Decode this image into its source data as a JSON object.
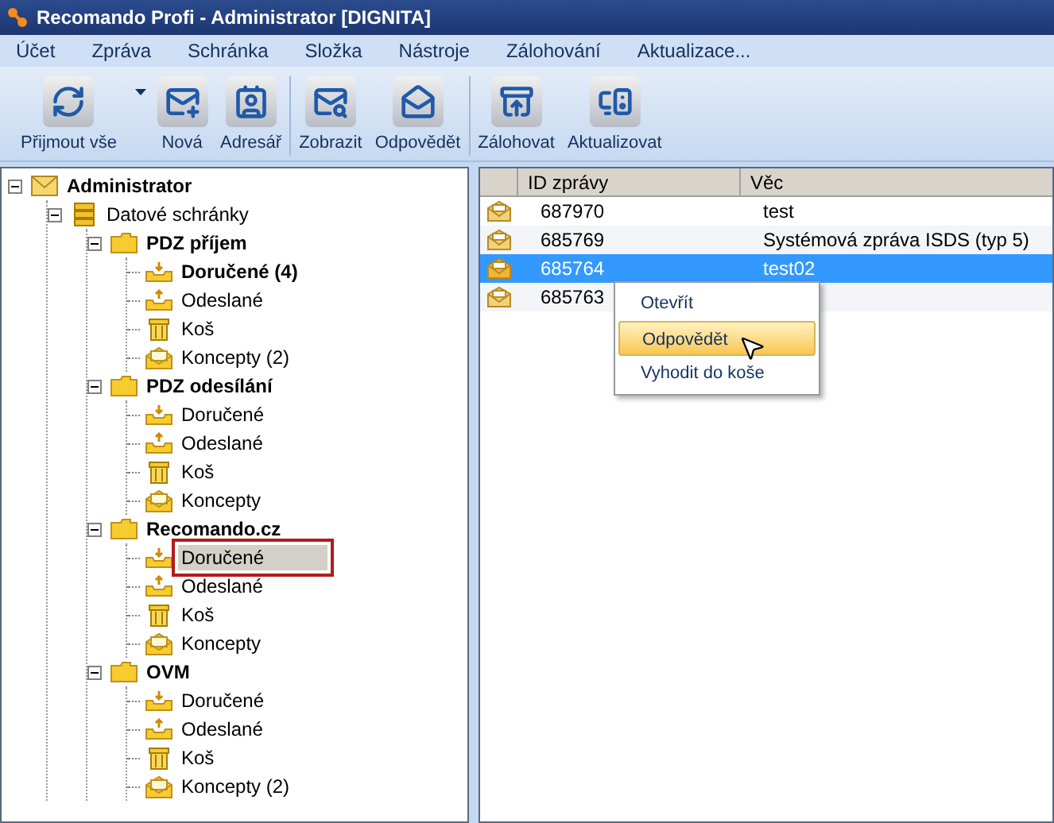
{
  "window": {
    "title": "Recomando Profi - Administrator [DIGNITA]"
  },
  "menu": [
    "Účet",
    "Zpráva",
    "Schránka",
    "Složka",
    "Nástroje",
    "Zálohování",
    "Aktualizace..."
  ],
  "toolbar": [
    [
      {
        "label": "Přijmout vše",
        "kind": "sync",
        "dropdown": true
      },
      {
        "label": "Nová",
        "kind": "new"
      },
      {
        "label": "Adresář",
        "kind": "contacts"
      }
    ],
    [
      {
        "label": "Zobrazit",
        "kind": "view"
      },
      {
        "label": "Odpovědět",
        "kind": "reply"
      }
    ],
    [
      {
        "label": "Zálohovat",
        "kind": "backup"
      },
      {
        "label": "Aktualizovat",
        "kind": "update"
      }
    ]
  ],
  "tree": [
    {
      "label": "Administrator",
      "kind": "account",
      "bold": true,
      "expanded": true,
      "selected": false,
      "children": [
        {
          "label": "Datové schránky",
          "kind": "boxes",
          "bold": false,
          "expanded": true,
          "selected": false,
          "children": [
            {
              "label": "PDZ příjem",
              "kind": "folder",
              "bold": true,
              "expanded": true,
              "selected": false,
              "children": [
                {
                  "label": "Doručené (4)",
                  "kind": "inbox",
                  "bold": true,
                  "selected": false
                },
                {
                  "label": "Odeslané",
                  "kind": "outbox",
                  "bold": false,
                  "selected": false
                },
                {
                  "label": "Koš",
                  "kind": "trash",
                  "bold": false,
                  "selected": false
                },
                {
                  "label": "Koncepty (2)",
                  "kind": "drafts",
                  "bold": false,
                  "selected": false
                }
              ]
            },
            {
              "label": "PDZ odesílání",
              "kind": "folder",
              "bold": true,
              "expanded": true,
              "selected": false,
              "children": [
                {
                  "label": "Doručené",
                  "kind": "inbox",
                  "bold": false,
                  "selected": false
                },
                {
                  "label": "Odeslané",
                  "kind": "outbox",
                  "bold": false,
                  "selected": false
                },
                {
                  "label": "Koš",
                  "kind": "trash",
                  "bold": false,
                  "selected": false
                },
                {
                  "label": "Koncepty",
                  "kind": "drafts",
                  "bold": false,
                  "selected": false
                }
              ]
            },
            {
              "label": "Recomando.cz",
              "kind": "folder",
              "bold": true,
              "expanded": true,
              "selected": false,
              "children": [
                {
                  "label": "Doručené",
                  "kind": "inbox",
                  "bold": false,
                  "selected": true
                },
                {
                  "label": "Odeslané",
                  "kind": "outbox",
                  "bold": false,
                  "selected": false
                },
                {
                  "label": "Koš",
                  "kind": "trash",
                  "bold": false,
                  "selected": false
                },
                {
                  "label": "Koncepty",
                  "kind": "drafts",
                  "bold": false,
                  "selected": false
                }
              ]
            },
            {
              "label": "OVM",
              "kind": "folder",
              "bold": true,
              "expanded": true,
              "selected": false,
              "children": [
                {
                  "label": "Doručené",
                  "kind": "inbox",
                  "bold": false,
                  "selected": false
                },
                {
                  "label": "Odeslané",
                  "kind": "outbox",
                  "bold": false,
                  "selected": false
                },
                {
                  "label": "Koš",
                  "kind": "trash",
                  "bold": false,
                  "selected": false
                },
                {
                  "label": "Koncepty (2)",
                  "kind": "drafts",
                  "bold": false,
                  "selected": false
                }
              ]
            }
          ]
        }
      ]
    }
  ],
  "table": {
    "columns": [
      "ID zprávy",
      "Věc"
    ],
    "rows": [
      {
        "id": "687970",
        "subject": "test",
        "selected": false
      },
      {
        "id": "685769",
        "subject": "Systémová zpráva ISDS (typ 5)",
        "selected": false
      },
      {
        "id": "685764",
        "subject": "test02",
        "selected": true
      },
      {
        "id": "685763",
        "selected": false
      }
    ]
  },
  "context_menu": [
    {
      "label": "Otevřít",
      "selected": false
    },
    {
      "label": "Odpovědět",
      "selected": true
    },
    {
      "label": "Vyhodit do koše",
      "selected": false
    }
  ]
}
